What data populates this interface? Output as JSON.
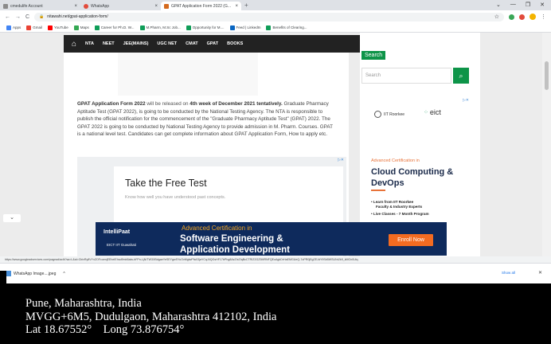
{
  "tabs": [
    {
      "label": "cmedulife Account",
      "fav_color": "#8a8a8a",
      "active": false
    },
    {
      "label": "WhatsApp",
      "fav_color": "#e24b3b",
      "active": false
    },
    {
      "label": "GPAT Application Form 2022 (G...",
      "fav_color": "#d46a1e",
      "active": true
    }
  ],
  "new_tab": "+",
  "tab_close": "×",
  "window_controls": [
    "⌄",
    "—",
    "❐",
    "✕"
  ],
  "address": {
    "url": "nitawahi.net/gpat-application-form/",
    "back": "←",
    "forward": "→",
    "reload": "C",
    "lock": "🔒",
    "star": "☆",
    "menu": "⋮"
  },
  "bookmarks": [
    "Apps",
    "Gmail",
    "YouTube",
    "Maps",
    "Career for Ph.D. W...",
    "M.Pharm, M.Sc Job...",
    "Opportunity for M....",
    "Feed | LinkedIn",
    "Benefits of Clearing..."
  ],
  "site_nav": {
    "home_icon": "⌂",
    "items": [
      "NTA",
      "NEET",
      "JEE(MAINS)",
      "UGC NET",
      "CMAT",
      "GPAT",
      "BOOKS"
    ],
    "search_icon": "⌕",
    "shuffle_icon": "⇄"
  },
  "article": {
    "lead_bold": "GPAT Application Form 2022",
    "lead_mid": " will be released on ",
    "date_bold": "4th week of December 2021 tentatively.",
    "body": " Graduate Pharmacy Aptitude Test (GPAT 2022), is going to be conducted by the National Testing Agency. The NTA is responsible to publish the official notification for the commencement of the \"Graduate Pharmacy Aptitude Test\" (GPAT) 2022. The GPAT 2022 is going to be conducted by National Testing Agency to provide admission in M. Pharm. Courses. GPAT is a national level test. Candidates can get complete information about GPAT Application Form, How to apply etc."
  },
  "ad_test": {
    "title": "Take the Free Test",
    "subtitle": "Know how well you have understood past concepts.",
    "adchoices": "▷✕"
  },
  "sidebar": {
    "search_heading": "Search",
    "search_placeholder": "Search",
    "search_button_icon": "⌕",
    "iit": "IIT Roorkee",
    "eict": "eict",
    "adv_label": "Advanced Certification in",
    "course_title": "Cloud Computing & DevOps",
    "bullets": [
      "• Learn from IIT Roorkee",
      "Faculty & Industry Experts",
      "• Live Classes - 7 Month Program"
    ]
  },
  "banner": {
    "logo": "IntelliPaat",
    "guwahati": "EICT IIT Guwahati",
    "adv": "Advanced Certification in",
    "headline1": "Software Engineering &",
    "headline2": "Application Development",
    "enroll": "Enroll Now"
  },
  "status_url": "https://www.googleadservices.com/pagead/aclk?sa=L&ai=CbivRy8VYxZOFcoenjEEheIEhsd9mb5aiw-bFPn-LjN/TW3XBdgaeYeSEYgwSYuOvMgtwPfaX3jaYCqJ4QGsHF17bPhg8AzZIxZIqBcCTRIZ2GZ5MRNFQEoAgkDrHaEMGUeQ-7oPR0jEgZEJdY9Sb5WSUNr2k9_kMOx0Uiq",
  "download": {
    "file": "WhatsApp Image....jpeg",
    "chevron": "^",
    "show_all": "Show all",
    "close": "✕"
  },
  "geotag": {
    "line1": "Pune, Maharashtra, India",
    "line2": "MVGG+6M5, Dudulgaon, Maharashtra 412102, India",
    "line3": "Lat 18.67552°    Long 73.876754°"
  },
  "collapse_icon": "⌄"
}
